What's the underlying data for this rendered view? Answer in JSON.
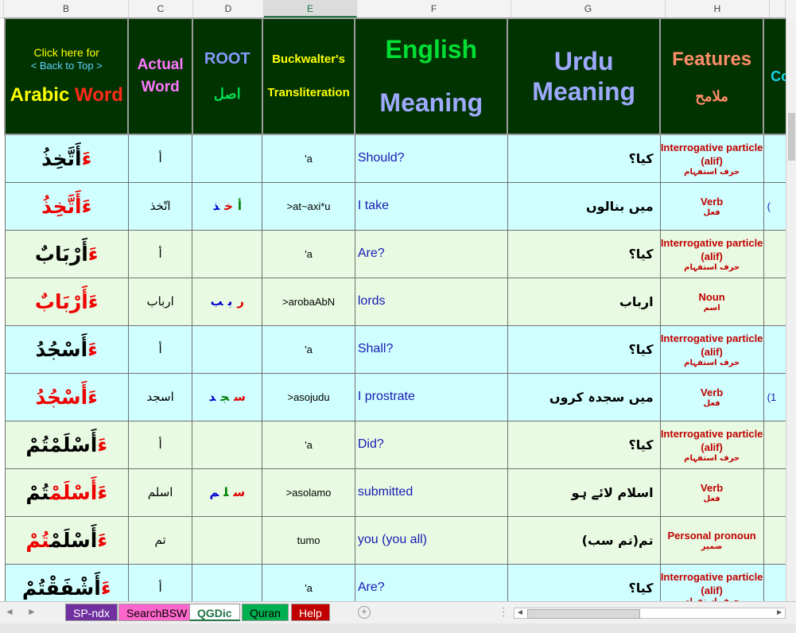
{
  "column_letters": [
    "B",
    "C",
    "D",
    "E",
    "F",
    "G",
    "H"
  ],
  "selected_column": "E",
  "header": {
    "b_click_here": "Click here for",
    "b_back_to_top": "< Back to Top >",
    "b_arabic": "Arabic",
    "b_word": "Word",
    "c_label": "Actual Word",
    "d_root": "ROOT",
    "d_root_ar": "اصل",
    "e_label": "Buckwalter's Transliteration",
    "f_line1": "English",
    "f_line2": "Meaning",
    "g_label": "Urdu Meaning",
    "h_label": "Features",
    "h_label_ar": "ملامح",
    "i_cut": "Co"
  },
  "rows": [
    {
      "prefix": "ءَ",
      "arabic_black": "أَتَّخِذُ",
      "arabic_red": "",
      "actual": "أ",
      "root": [],
      "bw": "'a",
      "english": "Should?",
      "urdu": "کیا؟",
      "feature_en": "Interrogative particle (alif)",
      "feature_ar": "حرف استفہام",
      "extra": "",
      "style": "cy"
    },
    {
      "prefix": "ءَ",
      "arabic_black": "",
      "arabic_red": "أَتَّخِذُ",
      "actual": "اتّخذ",
      "root": [
        {
          "t": "أ",
          "c": "#008000"
        },
        {
          "t": "خ",
          "c": "#e00000"
        },
        {
          "t": "ذ",
          "c": "#0000cc"
        }
      ],
      "bw": ">at~axi*u",
      "english": "I take",
      "urdu": "میں بنالوں",
      "feature_en": "Verb",
      "feature_ar": "فعل",
      "extra": "(",
      "style": "cy"
    },
    {
      "prefix": "ءَ",
      "arabic_black": "أَرْبَابٌ",
      "arabic_red": "",
      "actual": "أ",
      "root": [],
      "bw": "'a",
      "english": "Are?",
      "urdu": "کیا؟",
      "feature_en": "Interrogative particle (alif)",
      "feature_ar": "حرف استفہام",
      "extra": "",
      "style": "gr"
    },
    {
      "prefix": "ءَ",
      "arabic_black": "",
      "arabic_red": "أَرْبَابٌ",
      "actual": "ارباب",
      "root": [
        {
          "t": "ر",
          "c": "#e00000"
        },
        {
          "t": "ب",
          "c": "#0000cc"
        },
        {
          "t": "ب",
          "c": "#0000cc"
        }
      ],
      "bw": ">arobaAbN",
      "english": "lords",
      "urdu": "ارباب",
      "feature_en": "Noun",
      "feature_ar": "اسم",
      "extra": "",
      "style": "gr"
    },
    {
      "prefix": "ءَ",
      "arabic_black": "أَسْجُدُ",
      "arabic_red": "",
      "actual": "أ",
      "root": [],
      "bw": "'a",
      "english": "Shall?",
      "urdu": "کیا؟",
      "feature_en": "Interrogative particle (alif)",
      "feature_ar": "حرف استفہام",
      "extra": "",
      "style": "cy"
    },
    {
      "prefix": "ءَ",
      "arabic_black": "",
      "arabic_red": "أَسْجُدُ",
      "actual": "اسجد",
      "root": [
        {
          "t": "س",
          "c": "#e00000"
        },
        {
          "t": "ج",
          "c": "#008000"
        },
        {
          "t": "د",
          "c": "#0000cc"
        }
      ],
      "bw": ">asojudu",
      "english": "I prostrate",
      "urdu": "میں سجدہ کروں",
      "feature_en": "Verb",
      "feature_ar": "فعل",
      "extra": "(1",
      "style": "cy"
    },
    {
      "prefix": "ءَ",
      "arabic_black": "أَسْلَمْتُمْ",
      "arabic_red": "",
      "actual": "أ",
      "root": [],
      "bw": "'a",
      "english": "Did?",
      "urdu": "کیا؟",
      "feature_en": "Interrogative particle (alif)",
      "feature_ar": "حرف استفہام",
      "extra": "",
      "style": "gr"
    },
    {
      "prefix": "ءَ",
      "arabic_black": "",
      "arabic_red": "أَسْلَمْ",
      "arabic_tail": "تُمْ",
      "actual": "اسلم",
      "root": [
        {
          "t": "س",
          "c": "#e00000"
        },
        {
          "t": "ل",
          "c": "#008000"
        },
        {
          "t": "م",
          "c": "#0000cc"
        }
      ],
      "bw": ">asolamo",
      "english": "submitted",
      "urdu": "اسلام لائے ہو",
      "feature_en": "Verb",
      "feature_ar": "فعل",
      "extra": "",
      "style": "gr"
    },
    {
      "prefix": "ءَ",
      "arabic_black": "أَسْلَمْ",
      "arabic_red": "تُمْ",
      "actual": "تم",
      "root": [],
      "bw": "tumo",
      "english": "you (you all)",
      "urdu": "تم(تم سب)",
      "feature_en": "Personal pronoun",
      "feature_ar": "ضمیر",
      "extra": "",
      "style": "gr"
    },
    {
      "prefix": "ءَ",
      "arabic_black": "أَشْفَقْتُمْ",
      "arabic_red": "",
      "actual": "أ",
      "root": [],
      "bw": "'a",
      "english": "Are?",
      "urdu": "کیا؟",
      "feature_en": "Interrogative particle (alif)",
      "feature_ar": "حرف استفہام",
      "extra": "",
      "style": "cy"
    }
  ],
  "tabs": [
    {
      "label": "SP-ndx",
      "bg": "#7030a0",
      "fg": "#ffffff"
    },
    {
      "label": "SearchBSW",
      "bg": "#ff66cc",
      "fg": "#000000"
    },
    {
      "label": "QGDic",
      "bg": "#ffffff",
      "fg": "#217346",
      "active": true
    },
    {
      "label": "Quran",
      "bg": "#00b050",
      "fg": "#000000"
    },
    {
      "label": "Help",
      "bg": "#c00000",
      "fg": "#ffffff"
    }
  ],
  "add_sheet_symbol": "+",
  "nav_left": "◄",
  "nav_right": "►",
  "dots": "⋮"
}
